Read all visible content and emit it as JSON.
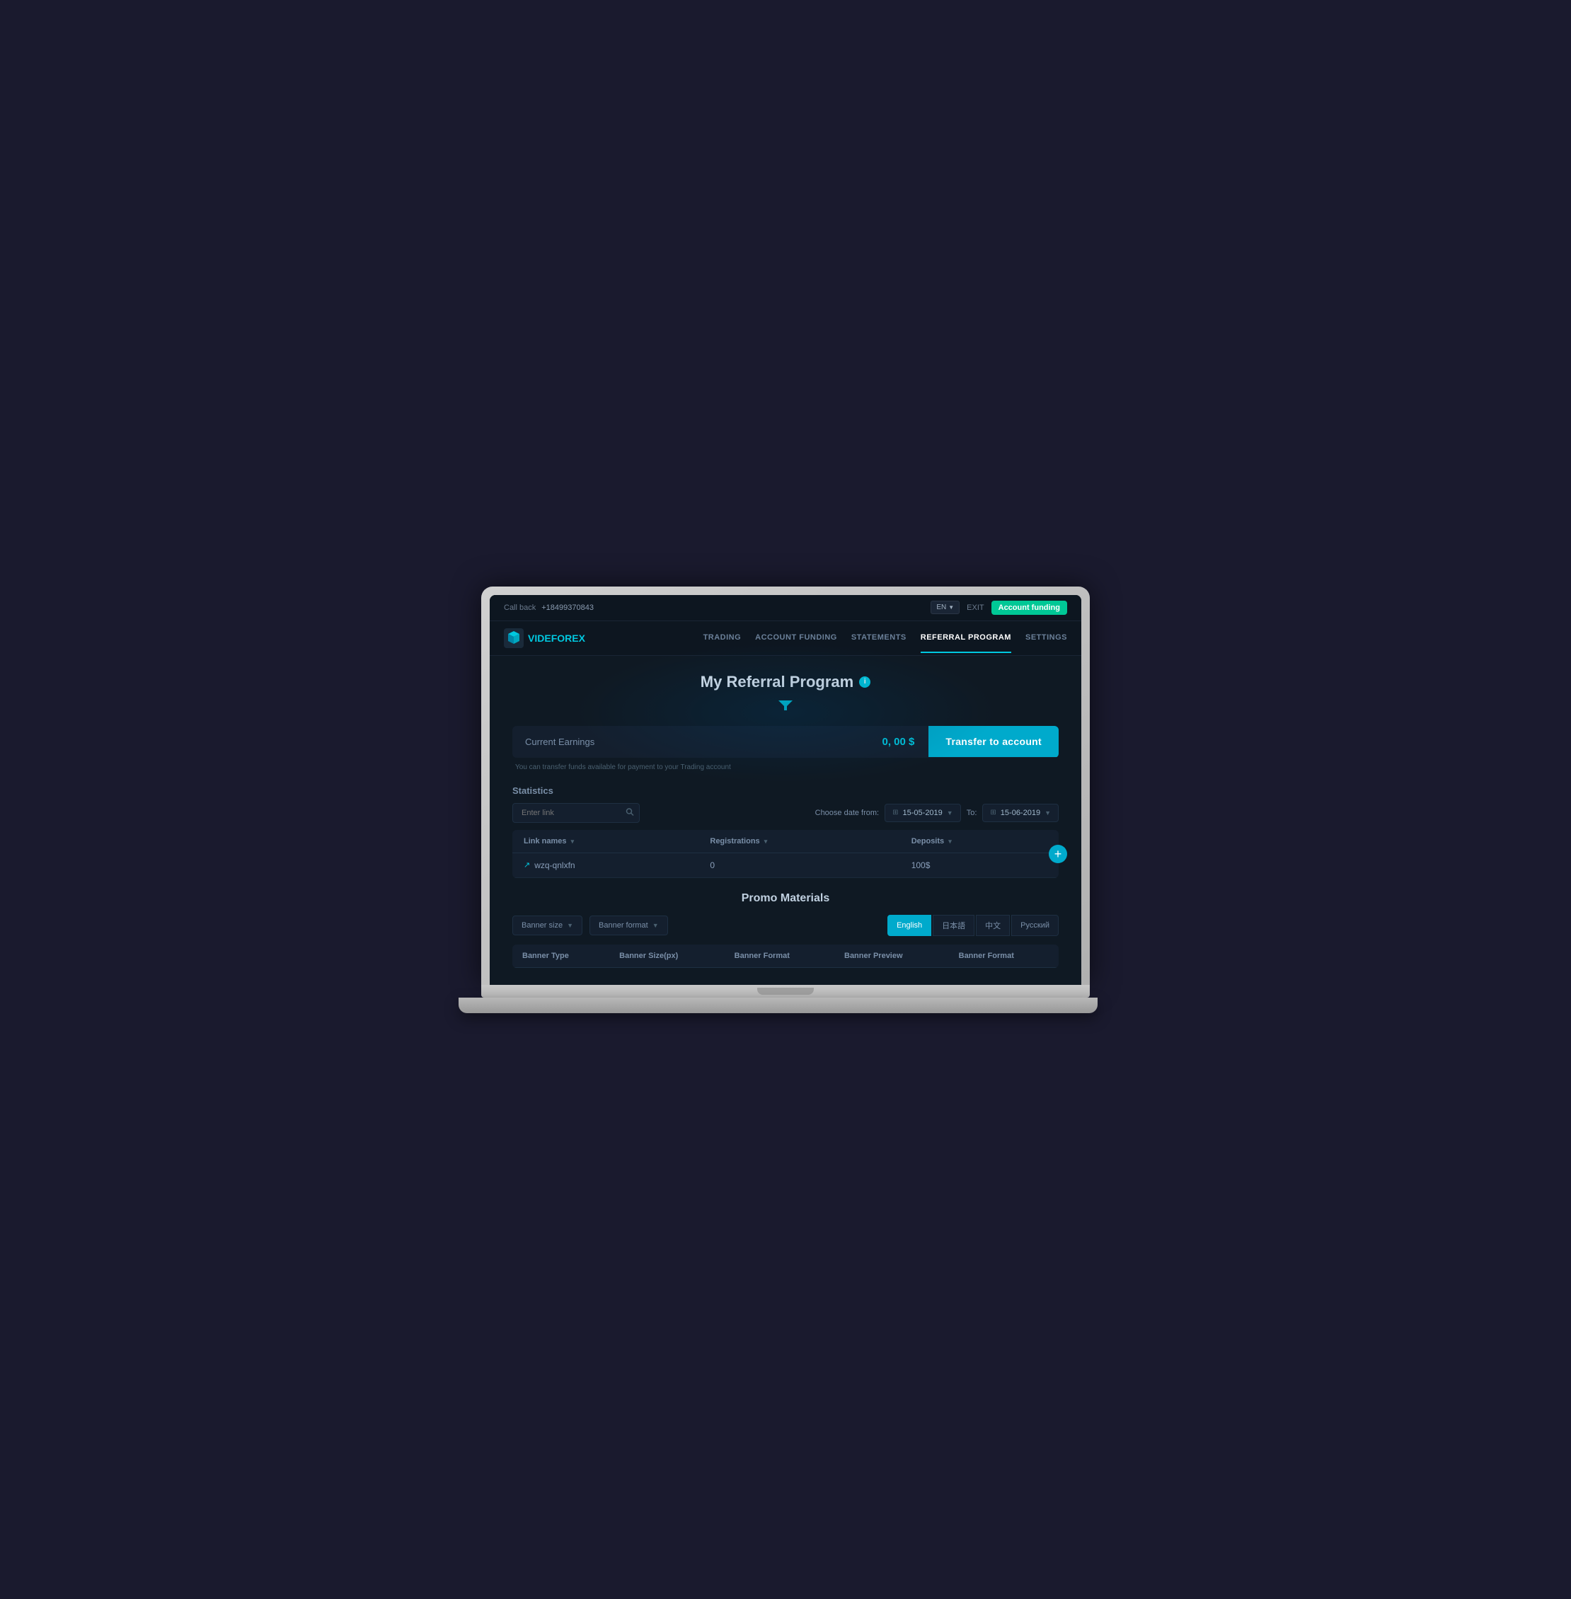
{
  "topbar": {
    "callback_label": "Call back",
    "phone": "+18499370843",
    "lang": "EN",
    "exit_label": "EXIT",
    "account_funding_btn": "Account funding"
  },
  "navbar": {
    "logo_text_vide": "VIDE",
    "logo_text_forex": "FOREX",
    "links": [
      {
        "label": "TRADING",
        "active": false
      },
      {
        "label": "ACCOUNT FUNDING",
        "active": false
      },
      {
        "label": "STATEMENTS",
        "active": false
      },
      {
        "label": "REFERRAL PROGRAM",
        "active": true
      },
      {
        "label": "SETTINGS",
        "active": false
      }
    ]
  },
  "page": {
    "title": "My Referral Program",
    "earnings": {
      "label": "Current Earnings",
      "value": "0, 00 $",
      "transfer_btn": "Transfer to account",
      "note": "You can transfer funds available for payment to your Trading account"
    },
    "statistics": {
      "title": "Statistics",
      "search_placeholder": "Enter link",
      "date_from_label": "Choose date from:",
      "date_from": "15-05-2019",
      "date_to_label": "To:",
      "date_to": "15-06-2019",
      "table_headers": [
        {
          "label": "Link names",
          "sort": true
        },
        {
          "label": "Registrations",
          "sort": true
        },
        {
          "label": "Deposits",
          "sort": true
        }
      ],
      "table_rows": [
        {
          "link": "wzq-qnlxfn",
          "registrations": "0",
          "deposits": "100$"
        }
      ]
    },
    "promo": {
      "title": "Promo Materials",
      "banner_size_label": "Banner size",
      "banner_format_label": "Banner format",
      "lang_tabs": [
        {
          "label": "English",
          "active": true
        },
        {
          "label": "日本語",
          "active": false
        },
        {
          "label": "中文",
          "active": false
        },
        {
          "label": "Русский",
          "active": false
        }
      ],
      "table_headers": [
        "Banner Type",
        "Banner Size(px)",
        "Banner Format",
        "Banner Preview",
        "Banner Format"
      ]
    }
  }
}
